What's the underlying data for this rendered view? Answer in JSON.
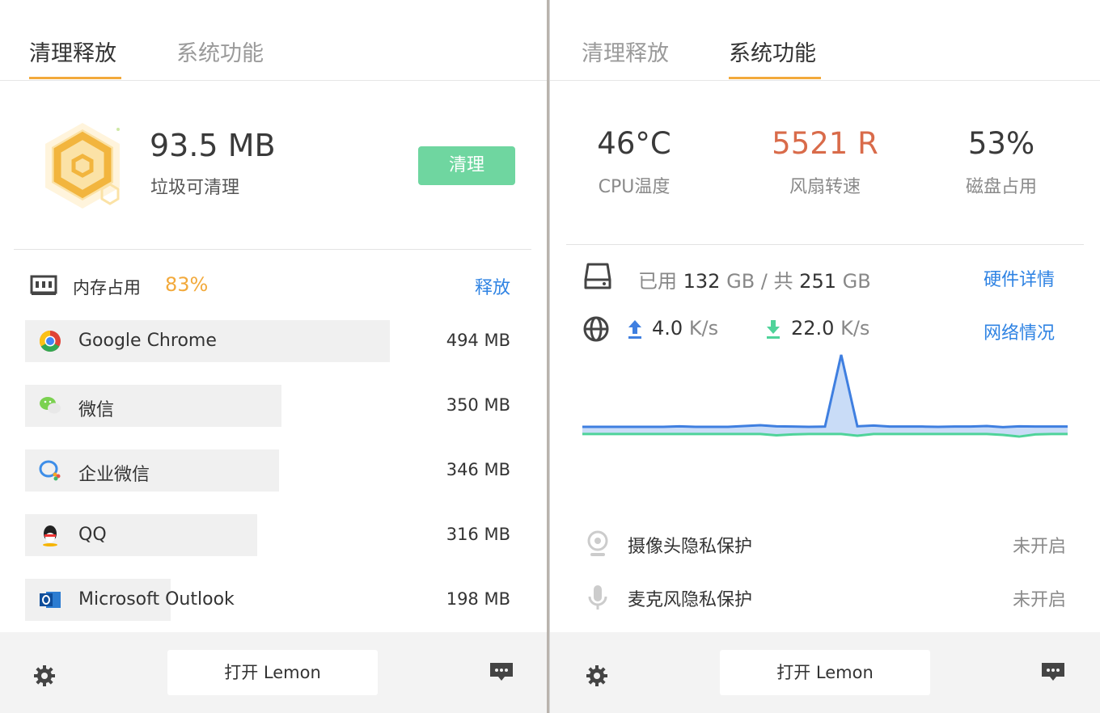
{
  "left": {
    "tabs": [
      "清理释放",
      "系统功能"
    ],
    "junk": {
      "size": "93.5 MB",
      "label": "垃圾可清理",
      "clean_button": "清理"
    },
    "memory": {
      "label": "内存占用",
      "value": "83%",
      "release_link": "释放"
    },
    "processes": [
      {
        "name": "Google Chrome",
        "memory": "494 MB",
        "icon": "chrome-icon",
        "usage_fraction": 0.74
      },
      {
        "name": "微信",
        "memory": "350 MB",
        "icon": "wechat-icon",
        "usage_fraction": 0.52
      },
      {
        "name": "企业微信",
        "memory": "346 MB",
        "icon": "wecom-icon",
        "usage_fraction": 0.515
      },
      {
        "name": "QQ",
        "memory": "316 MB",
        "icon": "qq-icon",
        "usage_fraction": 0.47
      },
      {
        "name": "Microsoft Outlook",
        "memory": "198 MB",
        "icon": "outlook-icon",
        "usage_fraction": 0.295
      }
    ],
    "footer": {
      "open_button": "打开 Lemon"
    }
  },
  "right": {
    "tabs": [
      "清理释放",
      "系统功能"
    ],
    "stats": [
      {
        "value": "46°C",
        "label": "CPU温度"
      },
      {
        "value": "5521 R",
        "label": "风扇转速"
      },
      {
        "value": "53%",
        "label": "磁盘占用"
      }
    ],
    "disk": {
      "used_label": "已用",
      "used_value": "132",
      "used_unit": "GB",
      "sep": "/",
      "total_label": "共",
      "total_value": "251",
      "total_unit": "GB",
      "link": "硬件详情"
    },
    "network": {
      "up_value": "4.0",
      "up_unit": "K/s",
      "down_value": "22.0",
      "down_unit": "K/s",
      "link": "网络情况"
    },
    "privacy": [
      {
        "label": "摄像头隐私保护",
        "status": "未开启",
        "icon": "camera-icon"
      },
      {
        "label": "麦克风隐私保护",
        "status": "未开启",
        "icon": "microphone-icon"
      }
    ],
    "footer": {
      "open_button": "打开 Lemon"
    }
  },
  "chart_data": {
    "type": "area",
    "series": [
      {
        "values": [
          4,
          4,
          4,
          4,
          4,
          4,
          4.2,
          4,
          4,
          4,
          4.3,
          4.6,
          4.2,
          4.1,
          4.0,
          4.1,
          31,
          4.2,
          4.5,
          4.1,
          4.1,
          4.1,
          4,
          4.1,
          4.1,
          4.3,
          3.9,
          4.2,
          4.1,
          4.1,
          4.1
        ]
      },
      {
        "values": [
          22,
          22,
          22,
          22,
          22,
          22,
          22,
          22,
          22,
          22,
          22,
          22,
          20.5,
          21.5,
          22,
          22,
          22,
          20,
          22,
          22,
          22,
          22,
          22,
          22,
          22,
          22,
          21,
          19,
          21.5,
          22,
          22
        ]
      }
    ],
    "colors": {
      "upload": "#3f7fe0",
      "download": "#4fd39a"
    }
  },
  "colors": {
    "accent": "#f2a93b",
    "link": "#2f83e3",
    "clean": "#6fd6a0",
    "fan": "#d96b4a"
  }
}
